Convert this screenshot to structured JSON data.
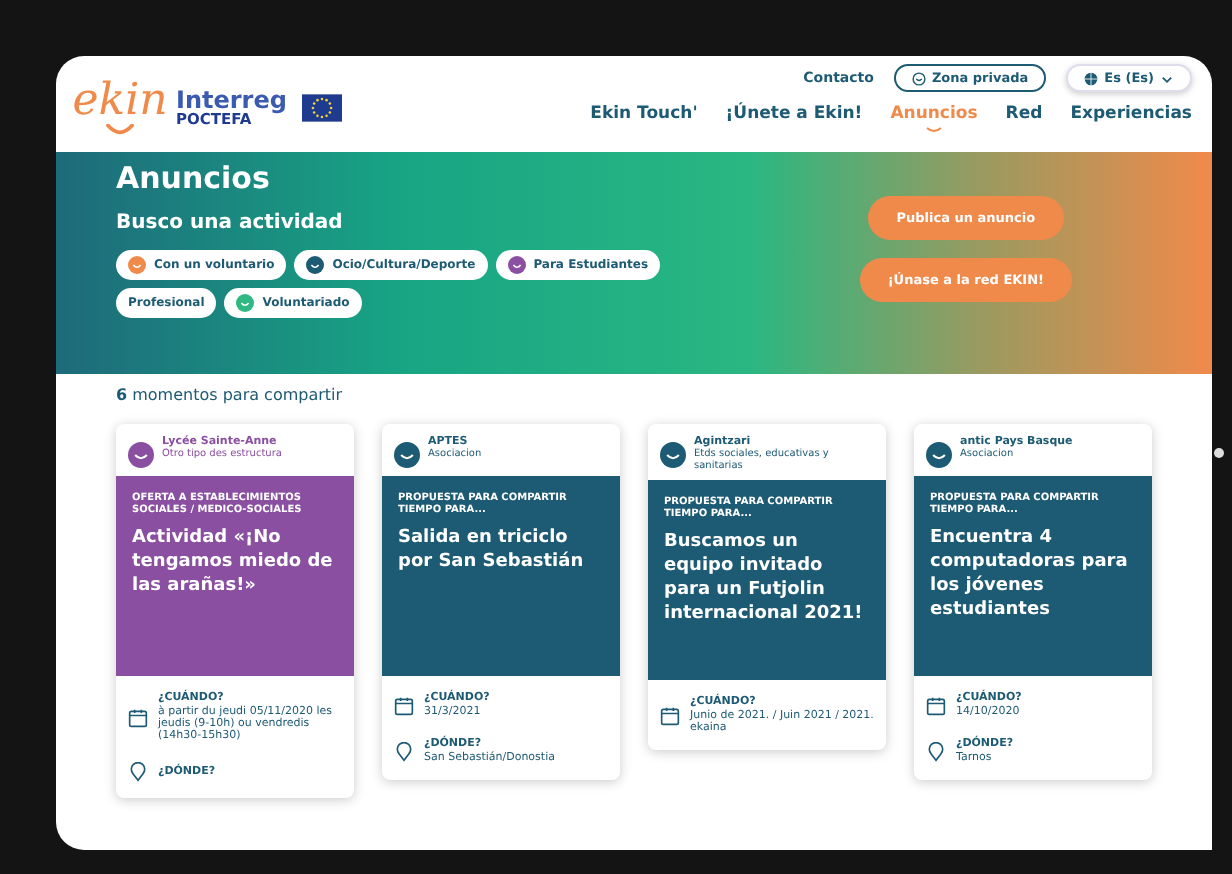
{
  "header": {
    "logo": "ekin",
    "partner_name": "Interreg",
    "partner_sub": "POCTEFA",
    "contact": "Contacto",
    "private_zone": "Zona privada",
    "language": "Es (Es)",
    "nav": [
      {
        "label": "Ekin Touch'",
        "selected": false
      },
      {
        "label": "¡Únete a Ekin!",
        "selected": false
      },
      {
        "label": "Anuncios",
        "selected": true
      },
      {
        "label": "Red",
        "selected": false
      },
      {
        "label": "Experiencias",
        "selected": false
      }
    ]
  },
  "banner": {
    "title": "Anuncios",
    "subtitle": "Busco una actividad",
    "filters": [
      {
        "label": "Con un voluntario",
        "color": "#f08a4b"
      },
      {
        "label": "Ocio/Cultura/Deporte",
        "color": "#1d5a73"
      },
      {
        "label": "Para Estudiantes",
        "color": "#8a4fa0"
      },
      {
        "label": "Profesional"
      },
      {
        "label": "Voluntariado",
        "color": "#2fb784"
      }
    ],
    "buttons": [
      "Publica un anuncio",
      "¡Únase a la red EKIN!"
    ]
  },
  "count": {
    "number": "6",
    "label": "momentos para compartir"
  },
  "cards": [
    {
      "org": "Lycée Sainte-Anne",
      "org_type": "Otro tipo des estructura",
      "color": "#8a4fa0",
      "category": "OFERTA A ESTABLECIMIENTOS SOCIALES / MEDICO-SOCIALES",
      "title": "Actividad «¡No tengamos miedo de las arañas!»",
      "when_label": "¿CUÁNDO?",
      "when": "à partir du jeudi 05/11/2020 les jeudis (9-10h) ou vendredis (14h30-15h30)",
      "where_label": "¿DÓNDE?"
    },
    {
      "org": "APTES",
      "org_type": "Asociacion",
      "color": "#1d5a73",
      "category": "PROPUESTA PARA COMPARTIR TIEMPO PARA...",
      "title": "Salida en triciclo por San Sebastián",
      "when_label": "¿CUÁNDO?",
      "when": "31/3/2021",
      "where_label": "¿DÓNDE?",
      "where": "San Sebastián/Donostia"
    },
    {
      "org": "Agintzari",
      "org_type": "Etds sociales, educativas y sanitarias",
      "color": "#1d5a73",
      "category": "PROPUESTA PARA COMPARTIR TIEMPO PARA...",
      "title": "Buscamos un equipo invitado para un Futjolin internacional 2021!",
      "when_label": "¿CUÁNDO?",
      "when": "Junio de 2021. / Juin 2021 / 2021. ekaina"
    },
    {
      "org": "antic Pays Basque",
      "org_type": "Asociacion",
      "color": "#1d5a73",
      "category": "PROPUESTA PARA COMPARTIR TIEMPO PARA...",
      "title": "Encuentra 4 computadoras para los jóvenes estudiantes",
      "when_label": "¿CUÁNDO?",
      "when": "14/10/2020",
      "where_label": "¿DÓNDE?",
      "where": "Tarnos"
    }
  ]
}
